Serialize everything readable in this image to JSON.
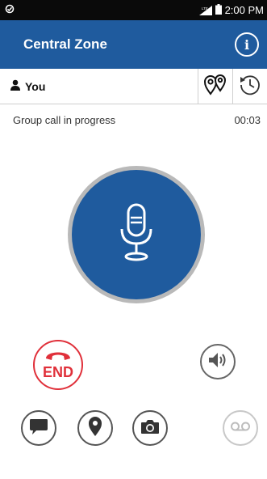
{
  "status_bar": {
    "time": "2:00 PM",
    "network_label": "LTE"
  },
  "app_bar": {
    "title": "Central Zone"
  },
  "sub_bar": {
    "user_label": "You"
  },
  "call": {
    "status_text": "Group call in progress",
    "timer": "00:03"
  },
  "controls": {
    "end_label": "END"
  },
  "colors": {
    "primary": "#1f5b9e",
    "end": "#e0303a",
    "ring": "#b9b9b9",
    "disabled": "#c8c8c8"
  },
  "icons": [
    "sync-icon",
    "signal-icon",
    "battery-icon",
    "info-icon",
    "person-icon",
    "map-pins-icon",
    "history-icon",
    "microphone-icon",
    "phone-end-icon",
    "speaker-icon",
    "chat-icon",
    "location-icon",
    "camera-icon",
    "voicemail-icon"
  ]
}
